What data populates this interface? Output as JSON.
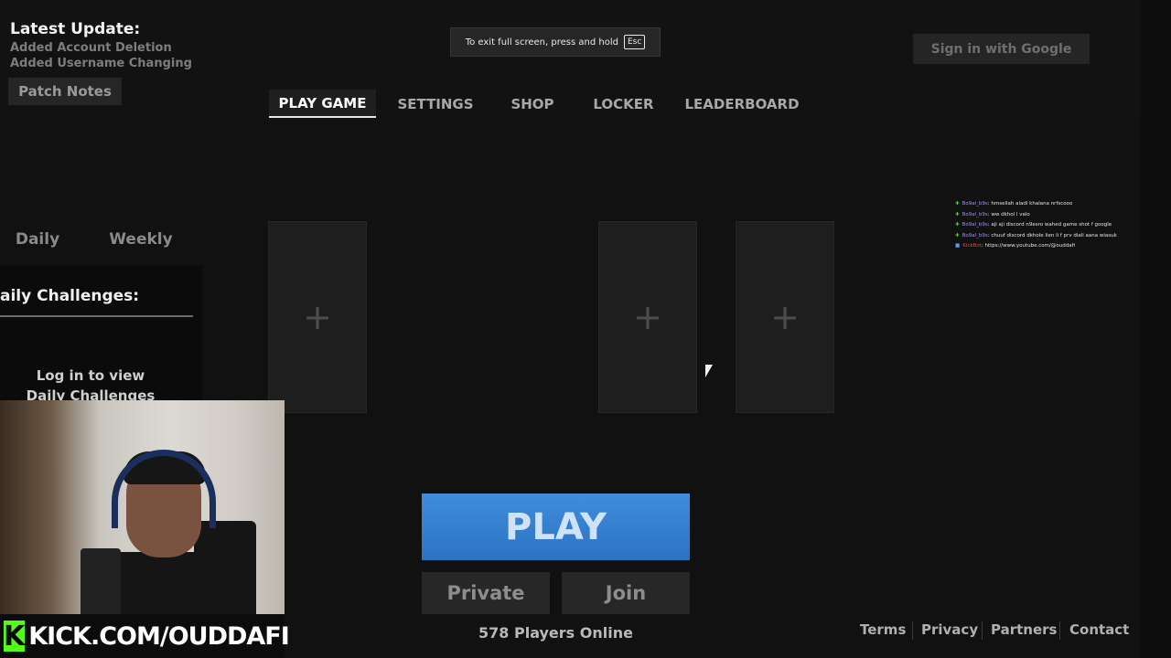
{
  "update": {
    "title": "Latest Update:",
    "lines": [
      "Added Account Deletion",
      "Added Username Changing"
    ],
    "patch_notes_label": "Patch Notes"
  },
  "fullscreen_toast": {
    "text": "To exit full screen, press and hold",
    "key": "Esc"
  },
  "header": {
    "google_label": "Sign in with Google"
  },
  "nav": {
    "tabs": [
      {
        "label": "PLAY GAME",
        "active": true
      },
      {
        "label": "SETTINGS"
      },
      {
        "label": "SHOP"
      },
      {
        "label": "LOCKER"
      },
      {
        "label": "LEADERBOARD"
      }
    ]
  },
  "challenges": {
    "tabs": [
      "Daily",
      "Weekly"
    ],
    "title": "aily Challenges:",
    "login_text_1": "Log in to view",
    "login_text_2": "Daily Challenges"
  },
  "slots": {
    "icon": "plus-icon",
    "symbol": "+"
  },
  "chat": {
    "messages": [
      {
        "user": "Bo9al_b9s",
        "text": ": hmsellah aladi khalana nrfscooo"
      },
      {
        "user": "Bo9al_b9s",
        "text": ": ww dkhol l valo"
      },
      {
        "user": "Bo9al_b9s",
        "text": ": aji aji discord n9esro wahed game shot f google"
      },
      {
        "user": "Bo9al_b9s",
        "text": ": chuuf discord dkhole lien li f prv diali aana wiasuk"
      },
      {
        "user": "KickBot",
        "text": ": https://www.youtube.com/@ouddafi"
      }
    ]
  },
  "stream": {
    "kick_letter": "K",
    "kick_url": "KICK.COM/OUDDAFI"
  },
  "main": {
    "play_label": "PLAY",
    "private_label": "Private",
    "join_label": "Join",
    "players_online": "578 Players Online"
  },
  "footer": {
    "links": [
      "Terms",
      "Privacy",
      "Partners",
      "Contact"
    ]
  },
  "colors": {
    "play_blue": "#3a86d6",
    "background": "#111111",
    "kick_green": "#53fc18"
  }
}
